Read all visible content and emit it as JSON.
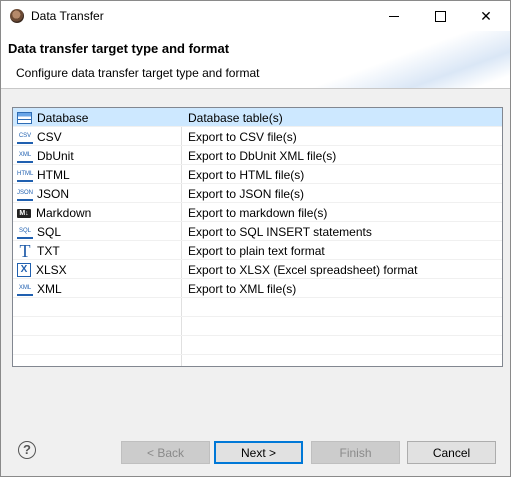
{
  "window": {
    "title": "Data Transfer"
  },
  "header": {
    "title": "Data transfer target type and format",
    "description": "Configure data transfer target type and format"
  },
  "formats": [
    {
      "name": "Database",
      "description": "Database table(s)",
      "icon": "database-table-icon",
      "selected": true
    },
    {
      "name": "CSV",
      "description": "Export to CSV file(s)",
      "icon": "csv-file-icon",
      "icon_text": "CSV"
    },
    {
      "name": "DbUnit",
      "description": "Export to DbUnit XML file(s)",
      "icon": "xml-file-icon",
      "icon_text": "XML"
    },
    {
      "name": "HTML",
      "description": "Export to HTML file(s)",
      "icon": "html-file-icon",
      "icon_text": "HTML"
    },
    {
      "name": "JSON",
      "description": "Export to JSON file(s)",
      "icon": "json-file-icon",
      "icon_text": "JSON"
    },
    {
      "name": "Markdown",
      "description": "Export to markdown file(s)",
      "icon": "markdown-icon",
      "icon_text": "M↓"
    },
    {
      "name": "SQL",
      "description": "Export to SQL INSERT statements",
      "icon": "sql-file-icon",
      "icon_text": "SQL"
    },
    {
      "name": "TXT",
      "description": "Export to plain text format",
      "icon": "text-format-icon",
      "icon_text": "T"
    },
    {
      "name": "XLSX",
      "description": "Export to XLSX (Excel spreadsheet) format",
      "icon": "excel-icon",
      "icon_text": "X"
    },
    {
      "name": "XML",
      "description": "Export to XML file(s)",
      "icon": "xml-file-icon",
      "icon_text": "XML"
    }
  ],
  "buttons": {
    "help": "?",
    "back": "< Back",
    "next": "Next >",
    "finish": "Finish",
    "cancel": "Cancel"
  },
  "colors": {
    "selection": "#cde8ff",
    "default_button_border": "#0078d7"
  }
}
